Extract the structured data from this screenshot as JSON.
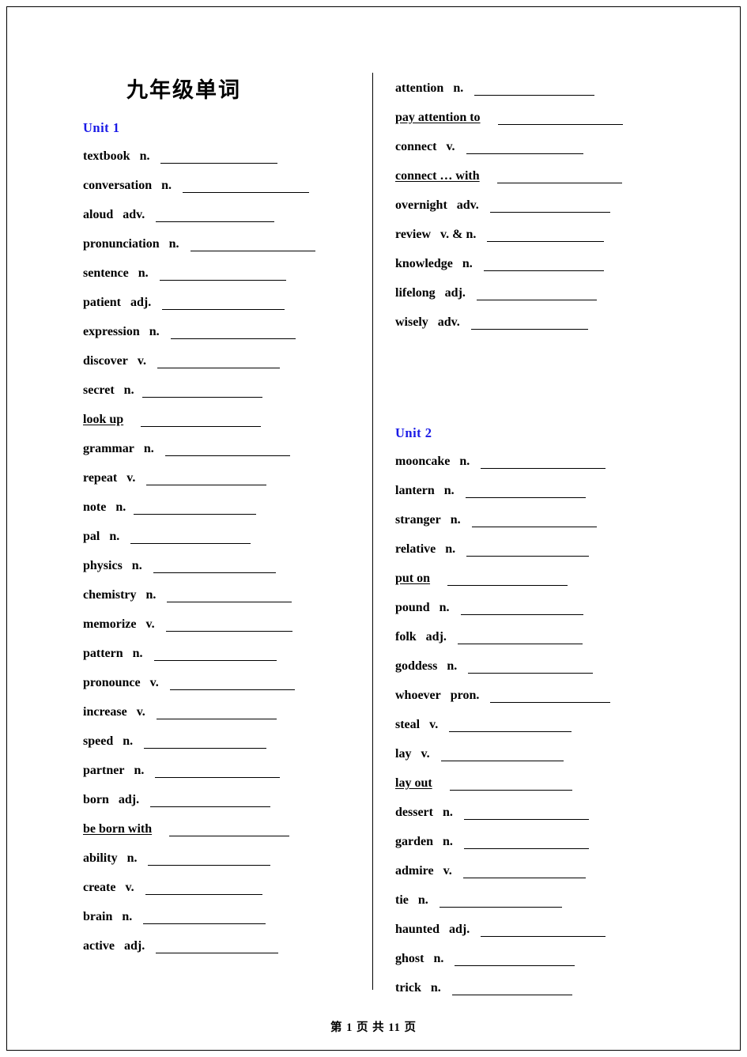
{
  "document": {
    "title": "九年级单词",
    "footer": "第 1 页 共 11 页"
  },
  "columns": {
    "left": {
      "units": [
        {
          "heading": "Unit 1",
          "entries": [
            {
              "word": "textbook",
              "pos": "n.",
              "underline": false,
              "blank": 148,
              "gap": 14
            },
            {
              "word": "conversation",
              "pos": "n.",
              "underline": false,
              "blank": 160,
              "gap": 14
            },
            {
              "word": "aloud",
              "pos": "adv.",
              "underline": false,
              "blank": 150,
              "gap": 14
            },
            {
              "word": "pronunciation",
              "pos": "n.",
              "underline": false,
              "blank": 158,
              "gap": 14
            },
            {
              "word": "sentence",
              "pos": "n.",
              "underline": false,
              "blank": 160,
              "gap": 14
            },
            {
              "word": "patient",
              "pos": "adj.",
              "underline": false,
              "blank": 155,
              "gap": 14
            },
            {
              "word": "expression",
              "pos": "n.",
              "underline": false,
              "blank": 158,
              "gap": 14
            },
            {
              "word": "discover",
              "pos": "v.",
              "underline": false,
              "blank": 155,
              "gap": 14
            },
            {
              "word": "secret",
              "pos": "n.",
              "underline": false,
              "blank": 152,
              "gap": 10
            },
            {
              "word": "look up",
              "pos": "",
              "underline": true,
              "blank": 152,
              "gap": 22
            },
            {
              "word": "grammar",
              "pos": "n.",
              "underline": false,
              "blank": 158,
              "gap": 14
            },
            {
              "word": "repeat",
              "pos": "v.",
              "underline": false,
              "blank": 152,
              "gap": 14
            },
            {
              "word": "note",
              "pos": "n.",
              "underline": false,
              "blank": 155,
              "gap": 10
            },
            {
              "word": "pal",
              "pos": "n.",
              "underline": false,
              "blank": 152,
              "gap": 14
            },
            {
              "word": "physics",
              "pos": "n.",
              "underline": false,
              "blank": 155,
              "gap": 14
            },
            {
              "word": "chemistry",
              "pos": "n.",
              "underline": false,
              "blank": 158,
              "gap": 14
            },
            {
              "word": "memorize",
              "pos": "v.",
              "underline": false,
              "blank": 160,
              "gap": 14
            },
            {
              "word": "pattern",
              "pos": "n.",
              "underline": false,
              "blank": 155,
              "gap": 14
            },
            {
              "word": "pronounce",
              "pos": "v.",
              "underline": false,
              "blank": 158,
              "gap": 14
            },
            {
              "word": "increase",
              "pos": "v.",
              "underline": false,
              "blank": 152,
              "gap": 14
            },
            {
              "word": "speed",
              "pos": "n.",
              "underline": false,
              "blank": 155,
              "gap": 14
            },
            {
              "word": "partner",
              "pos": "n.",
              "underline": false,
              "blank": 158,
              "gap": 14
            },
            {
              "word": "born",
              "pos": "adj.",
              "underline": false,
              "blank": 152,
              "gap": 14
            },
            {
              "word": "be born with",
              "pos": "",
              "underline": true,
              "blank": 152,
              "gap": 22
            },
            {
              "word": "ability",
              "pos": "n.",
              "underline": false,
              "blank": 155,
              "gap": 14
            },
            {
              "word": "create",
              "pos": "v.",
              "underline": false,
              "blank": 148,
              "gap": 14
            },
            {
              "word": "brain",
              "pos": "n.",
              "underline": false,
              "blank": 155,
              "gap": 14
            },
            {
              "word": "active",
              "pos": "adj.",
              "underline": false,
              "blank": 155,
              "gap": 14
            }
          ]
        }
      ]
    },
    "right": {
      "units": [
        {
          "heading": "",
          "entries": [
            {
              "word": "attention",
              "pos": "n.",
              "underline": false,
              "blank": 152,
              "gap": 14
            },
            {
              "word": "pay attention to",
              "pos": "",
              "underline": true,
              "blank": 158,
              "gap": 22
            },
            {
              "word": "connect",
              "pos": "v.",
              "underline": false,
              "blank": 148,
              "gap": 14
            },
            {
              "word": "connect … with",
              "pos": "",
              "underline": true,
              "blank": 158,
              "gap": 22
            },
            {
              "word": "overnight",
              "pos": "adv.",
              "underline": false,
              "blank": 152,
              "gap": 14
            },
            {
              "word": "review",
              "pos": "v. & n.",
              "underline": false,
              "blank": 148,
              "gap": 14
            },
            {
              "word": "knowledge",
              "pos": "n.",
              "underline": false,
              "blank": 152,
              "gap": 14
            },
            {
              "word": "lifelong",
              "pos": "adj.",
              "underline": false,
              "blank": 152,
              "gap": 14
            },
            {
              "word": "wisely",
              "pos": "adv.",
              "underline": false,
              "blank": 148,
              "gap": 14
            }
          ]
        },
        {
          "heading": "Unit 2",
          "entries": [
            {
              "word": "mooncake",
              "pos": "n.",
              "underline": false,
              "blank": 158,
              "gap": 14
            },
            {
              "word": "lantern",
              "pos": "n.",
              "underline": false,
              "blank": 152,
              "gap": 14
            },
            {
              "word": "stranger",
              "pos": "n.",
              "underline": false,
              "blank": 158,
              "gap": 14
            },
            {
              "word": "relative",
              "pos": "n.",
              "underline": false,
              "blank": 155,
              "gap": 14
            },
            {
              "word": "put on",
              "pos": "",
              "underline": true,
              "blank": 152,
              "gap": 22
            },
            {
              "word": "pound",
              "pos": "n.",
              "underline": false,
              "blank": 155,
              "gap": 14
            },
            {
              "word": "folk",
              "pos": "adj.",
              "underline": false,
              "blank": 158,
              "gap": 14
            },
            {
              "word": "goddess",
              "pos": "n.",
              "underline": false,
              "blank": 158,
              "gap": 14
            },
            {
              "word": "whoever",
              "pos": "pron.",
              "underline": false,
              "blank": 152,
              "gap": 14
            },
            {
              "word": "steal",
              "pos": "v.",
              "underline": false,
              "blank": 155,
              "gap": 14
            },
            {
              "word": "lay",
              "pos": "v.",
              "underline": false,
              "blank": 155,
              "gap": 14
            },
            {
              "word": "lay out",
              "pos": "",
              "underline": true,
              "blank": 155,
              "gap": 22
            },
            {
              "word": "dessert",
              "pos": "n.",
              "underline": false,
              "blank": 158,
              "gap": 14
            },
            {
              "word": "garden",
              "pos": "n.",
              "underline": false,
              "blank": 158,
              "gap": 14
            },
            {
              "word": "admire",
              "pos": "v.",
              "underline": false,
              "blank": 155,
              "gap": 14
            },
            {
              "word": "tie",
              "pos": "n.",
              "underline": false,
              "blank": 155,
              "gap": 14
            },
            {
              "word": "haunted",
              "pos": "adj.",
              "underline": false,
              "blank": 158,
              "gap": 14
            },
            {
              "word": "ghost",
              "pos": "n.",
              "underline": false,
              "blank": 152,
              "gap": 14
            },
            {
              "word": "trick",
              "pos": "n.",
              "underline": false,
              "blank": 152,
              "gap": 14
            }
          ]
        }
      ]
    }
  }
}
